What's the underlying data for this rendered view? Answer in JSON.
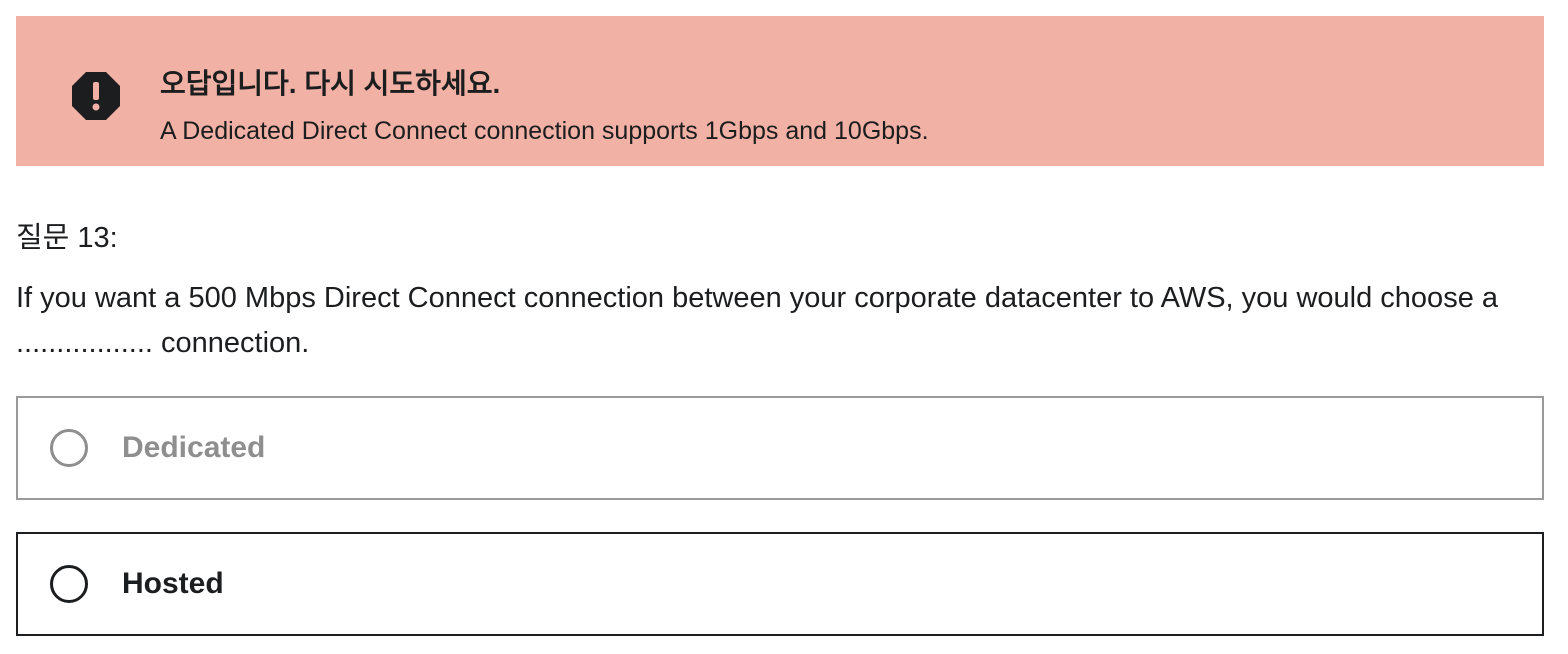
{
  "alert": {
    "icon": "alert-octagon-icon",
    "title": "오답입니다. 다시 시도하세요.",
    "message": "A Dedicated Direct Connect connection supports 1Gbps and 10Gbps.",
    "background_color": "#f1b1a5"
  },
  "question": {
    "number_label": "질문 13:",
    "text": "If you want a 500 Mbps Direct Connect connection between your corporate datacenter to AWS, you would choose a ................. connection."
  },
  "options": [
    {
      "label": "Dedicated",
      "state": "disabled-incorrect",
      "selected": false
    },
    {
      "label": "Hosted",
      "state": "available",
      "selected": false
    }
  ]
}
